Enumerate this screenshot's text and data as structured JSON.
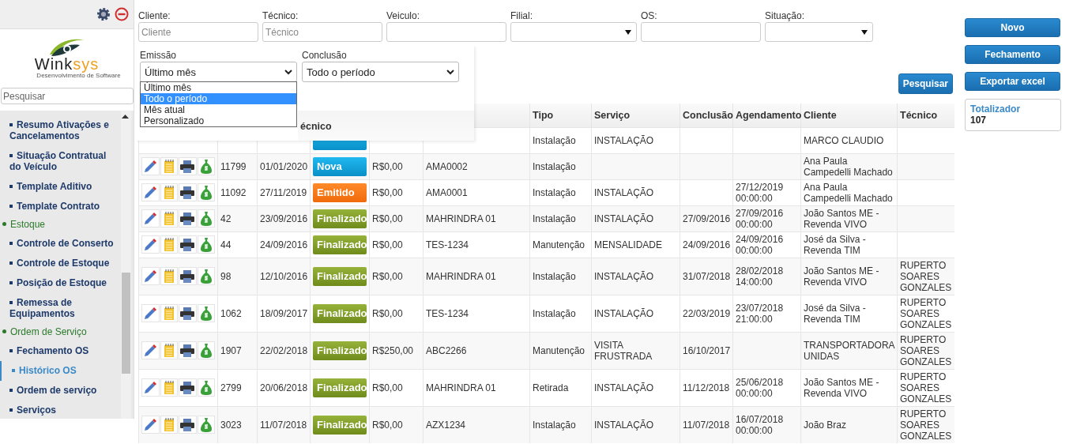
{
  "sidebar": {
    "logo": {
      "name_first": "Wink",
      "name_second": "sys",
      "tagline": "Desenvolvimento de Software"
    },
    "search": {
      "placeholder": "Pesquisar"
    },
    "items": [
      {
        "kind": "item",
        "label": "Resumo Ativações e Cancelamentos",
        "selected": false
      },
      {
        "kind": "item",
        "label": "Situação Contratual do Veículo",
        "selected": false
      },
      {
        "kind": "item",
        "label": "Template Aditivo",
        "selected": false
      },
      {
        "kind": "item",
        "label": "Template Contrato",
        "selected": false
      },
      {
        "kind": "group",
        "label": "Estoque",
        "selected": false
      },
      {
        "kind": "item",
        "label": "Controle de Conserto",
        "selected": false
      },
      {
        "kind": "item",
        "label": "Controle de Estoque",
        "selected": false
      },
      {
        "kind": "item",
        "label": "Posição de Estoque",
        "selected": false
      },
      {
        "kind": "item",
        "label": "Remessa de Equipamentos",
        "selected": false
      },
      {
        "kind": "group",
        "label": "Ordem de Serviço",
        "selected": false
      },
      {
        "kind": "item",
        "label": "Fechamento OS",
        "selected": false
      },
      {
        "kind": "item",
        "label": "Histórico OS",
        "selected": true
      },
      {
        "kind": "item",
        "label": "Ordem de serviço",
        "selected": false
      },
      {
        "kind": "item",
        "label": "Serviços",
        "selected": false
      }
    ]
  },
  "filters": [
    {
      "kind": "text",
      "label": "Cliente:",
      "placeholder": "Cliente"
    },
    {
      "kind": "text",
      "label": "Técnico:",
      "placeholder": "Técnico"
    },
    {
      "kind": "text",
      "label": "Veiculo:"
    },
    {
      "kind": "select",
      "label": "Filial:"
    },
    {
      "kind": "text",
      "label": "OS:"
    },
    {
      "kind": "select",
      "label": "Situação:"
    }
  ],
  "period_panel": {
    "emissao": {
      "label": "Emissão",
      "value": "Último mês",
      "options": [
        {
          "label": "Último mês",
          "highlighted": false
        },
        {
          "label": "Todo o período",
          "highlighted": true
        },
        {
          "label": "Mês atual",
          "highlighted": false
        },
        {
          "label": "Personalizado",
          "highlighted": false
        }
      ]
    },
    "conclusao": {
      "label": "Conclusão",
      "value": "Todo o período"
    },
    "header_fragment": "écnico"
  },
  "search_button": "Pesquisar",
  "table": {
    "columns": [
      "Tipo",
      "Serviço",
      "Conclusão",
      "Agendamento",
      "Cliente",
      "Técnico"
    ],
    "rows": [
      {
        "status": {
          "kind": "nova"
        },
        "tipo": "Instalação",
        "servico": "INSTALAÇÃO",
        "cliente": "MARCO CLAUDIO"
      },
      {
        "os": "11799",
        "date": "01/01/2020",
        "status": {
          "kind": "nova",
          "label": "Nova"
        },
        "valor": "R$0,00",
        "placa": "AMA0002",
        "tipo": "Instalação",
        "cliente": "Ana Paula Campedelli Machado"
      },
      {
        "os": "11092",
        "date": "27/11/2019",
        "status": {
          "kind": "emitido",
          "label": "Emitido"
        },
        "valor": "R$0,00",
        "placa": "AMA0001",
        "tipo": "Instalação",
        "servico": "INSTALAÇÃO",
        "agendamento": "27/12/2019 00:00:00",
        "cliente": "Ana Paula Campedelli Machado"
      },
      {
        "os": "42",
        "date": "23/09/2016",
        "status": {
          "kind": "finalizado",
          "label": "Finalizado"
        },
        "valor": "R$0,00",
        "placa": "MAHRINDRA 01",
        "tipo": "Instalação",
        "servico": "INSTALAÇÃO",
        "conclusao": "27/09/2016",
        "agendamento": "27/09/2016 00:00:00",
        "cliente": "João Santos ME - Revenda VIVO"
      },
      {
        "os": "44",
        "date": "24/09/2016",
        "status": {
          "kind": "finalizado",
          "label": "Finalizado"
        },
        "valor": "R$0,00",
        "placa": "TES-1234",
        "tipo": "Manutenção",
        "servico": "MENSALIDADE",
        "conclusao": "24/09/2016",
        "agendamento": "24/09/2016 00:00:00",
        "cliente": "José da Silva - Revenda TIM"
      },
      {
        "os": "98",
        "date": "12/10/2016",
        "status": {
          "kind": "finalizado",
          "label": "Finalizado"
        },
        "valor": "R$0,00",
        "placa": "MAHRINDRA 01",
        "tipo": "Instalação",
        "servico": "INSTALAÇÃO",
        "conclusao": "31/07/2018",
        "agendamento": "28/02/2018 14:00:00",
        "cliente": "João Santos ME - Revenda VIVO",
        "tecnico": "RUPERTO SOARES GONZALES"
      },
      {
        "os": "1062",
        "date": "18/09/2017",
        "status": {
          "kind": "finalizado",
          "label": "Finalizado"
        },
        "valor": "R$0,00",
        "placa": "TES-1234",
        "tipo": "Instalação",
        "servico": "INSTALAÇÃO",
        "conclusao": "22/03/2019",
        "agendamento": "23/07/2018 21:00:00",
        "cliente": "José da Silva - Revenda TIM",
        "tecnico": "RUPERTO SOARES GONZALES"
      },
      {
        "os": "1907",
        "date": "22/02/2018",
        "status": {
          "kind": "finalizado",
          "label": "Finalizado"
        },
        "valor": "R$250,00",
        "placa": "ABC2266",
        "tipo": "Manutenção",
        "servico": "VISITA FRUSTRADA",
        "conclusao": "16/10/2017",
        "cliente": "TRANSPORTADORA UNIDAS",
        "tecnico": "RUPERTO SOARES GONZALES"
      },
      {
        "os": "2799",
        "date": "20/06/2018",
        "status": {
          "kind": "finalizado",
          "label": "Finalizado"
        },
        "valor": "R$0,00",
        "placa": "MAHRINDRA 01",
        "tipo": "Retirada",
        "servico": "INSTALAÇÃO",
        "conclusao": "11/12/2018",
        "agendamento": "25/06/2018 00:00:00",
        "cliente": "João Santos ME - Revenda VIVO",
        "tecnico": "RUPERTO SOARES GONZALES"
      },
      {
        "os": "3023",
        "date": "11/07/2018",
        "status": {
          "kind": "finalizado",
          "label": "Finalizado"
        },
        "valor": "R$0,00",
        "placa": "AZX1234",
        "tipo": "Instalação",
        "servico": "INSTALAÇÃO",
        "conclusao": "11/07/2018",
        "agendamento": "16/07/2018 00:00:00",
        "cliente": "João Braz",
        "tecnico": "RUPERTO SOARES GONZALES"
      }
    ]
  },
  "actions": [
    "Novo",
    "Fechamento",
    "Exportar excel"
  ],
  "totalizer": {
    "label": "Totalizador",
    "value": "107"
  }
}
